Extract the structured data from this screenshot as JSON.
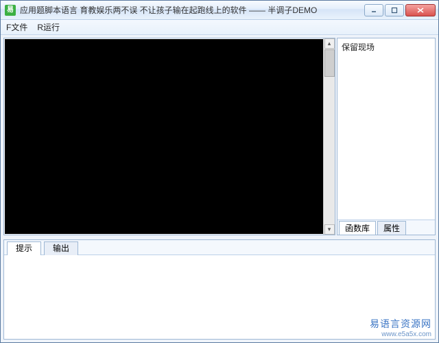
{
  "window": {
    "title": "应用题脚本语言 育教娱乐两不误 不让孩子输在起跑线上的软件 —— 半调子DEMO",
    "icon_glyph": "易"
  },
  "menu": {
    "file": "F文件",
    "run": "R运行"
  },
  "right_panel": {
    "body_text": "保留现场",
    "tabs": {
      "lib": "函数库",
      "props": "属性"
    }
  },
  "bottom_tabs": {
    "hint": "提示",
    "output": "输出"
  },
  "watermark": {
    "text": "易语言资源网",
    "url": "www.e5a5x.com"
  }
}
